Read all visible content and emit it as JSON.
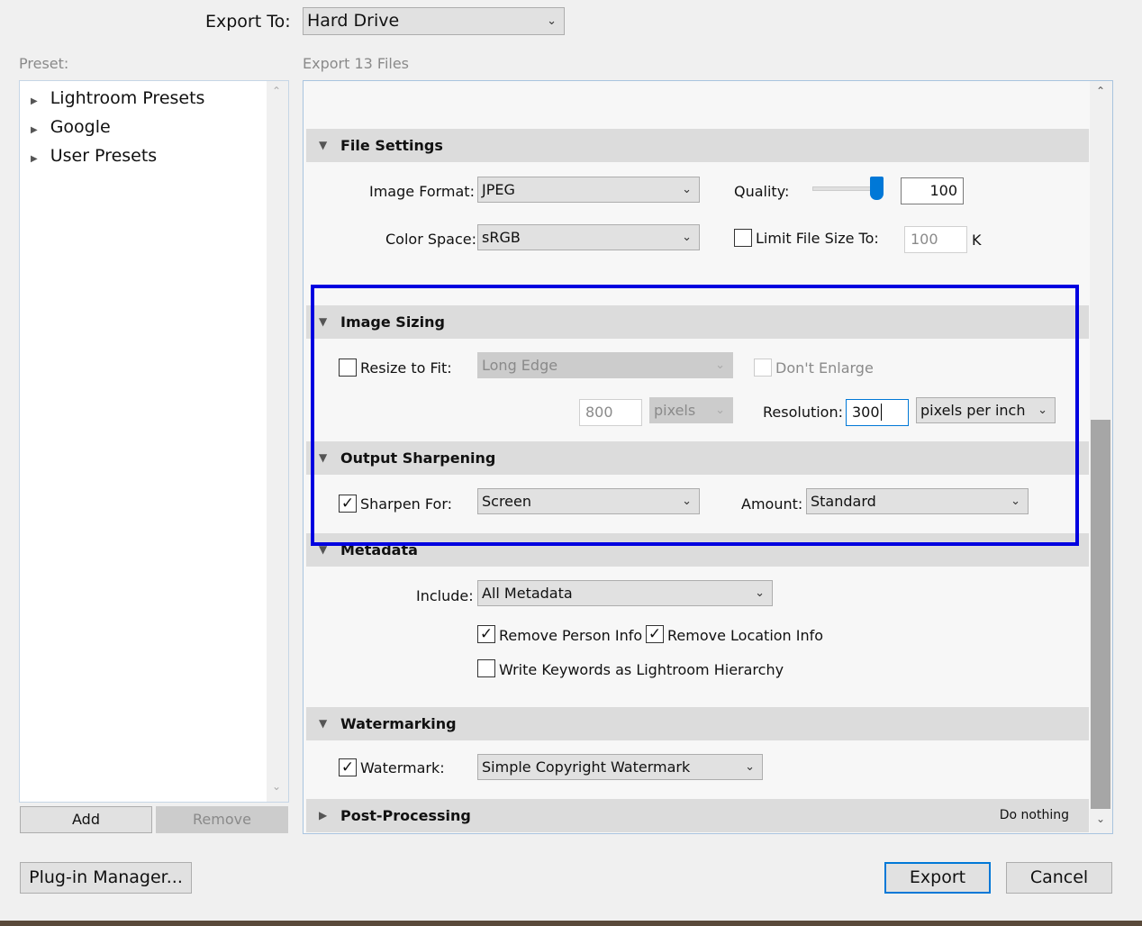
{
  "header": {
    "export_to_label": "Export To:",
    "export_to_value": "Hard Drive"
  },
  "preset": {
    "label": "Preset:",
    "items": [
      "Lightroom Presets",
      "Google",
      "User Presets"
    ],
    "add": "Add",
    "remove": "Remove"
  },
  "main": {
    "title": "Export 13 Files"
  },
  "file_settings": {
    "title": "File Settings",
    "image_format_label": "Image Format:",
    "image_format": "JPEG",
    "quality_label": "Quality:",
    "quality": "100",
    "quality_value": 100,
    "color_space_label": "Color Space:",
    "color_space": "sRGB",
    "limit_label": "Limit File Size To:",
    "limit_checked": false,
    "limit_value": "100",
    "limit_unit": "K"
  },
  "image_sizing": {
    "title": "Image Sizing",
    "resize_label": "Resize to Fit:",
    "resize_checked": false,
    "resize_mode": "Long Edge",
    "dont_enlarge": "Don't Enlarge",
    "size_value": "800",
    "size_unit": "pixels",
    "resolution_label": "Resolution:",
    "resolution": "300",
    "resolution_unit": "pixels per inch"
  },
  "output_sharpening": {
    "title": "Output Sharpening",
    "sharpen_label": "Sharpen For:",
    "sharpen_checked": true,
    "sharpen_for": "Screen",
    "amount_label": "Amount:",
    "amount": "Standard"
  },
  "metadata": {
    "title": "Metadata",
    "include_label": "Include:",
    "include": "All Metadata",
    "remove_person": "Remove Person Info",
    "remove_location": "Remove Location Info",
    "write_keywords": "Write Keywords as Lightroom Hierarchy"
  },
  "watermarking": {
    "title": "Watermarking",
    "watermark_label": "Watermark:",
    "watermark": "Simple Copyright Watermark",
    "watermark_checked": true
  },
  "post_processing": {
    "title": "Post-Processing",
    "value": "Do nothing"
  },
  "footer": {
    "plugin_manager": "Plug-in Manager...",
    "export": "Export",
    "cancel": "Cancel"
  },
  "colors": {
    "highlight": "#0000e0",
    "accent": "#0078d7"
  }
}
